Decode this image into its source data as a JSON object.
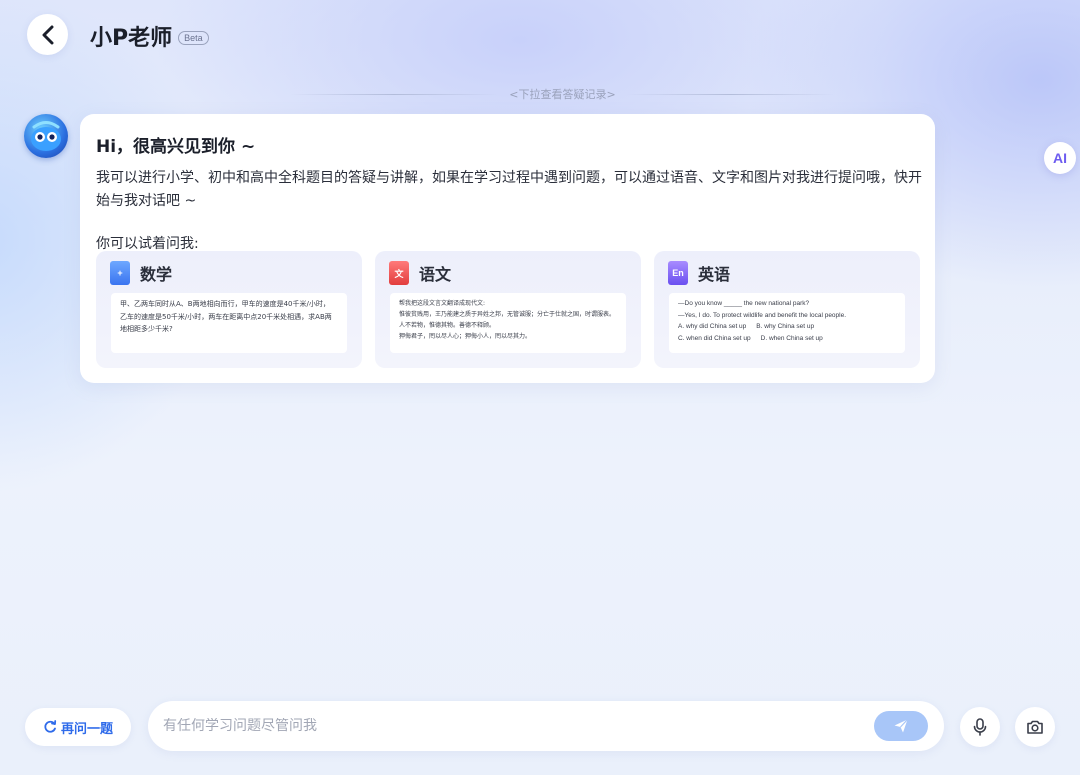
{
  "header": {
    "title": "小P老师",
    "badge": "Beta",
    "history_hint": "<下拉查看答疑记录>"
  },
  "message": {
    "greeting": "Hi，很高兴见到你 ~",
    "intro": "我可以进行小学、初中和高中全科题目的答疑与讲解，如果在学习过程中遇到问题，可以通过语音、文字和图片对我进行提问哦，快开始与我对话吧 ~",
    "try_label": "你可以试着问我:"
  },
  "subjects": [
    {
      "name": "数学",
      "icon": "math-book-icon",
      "lines": [
        "甲、乙两车同时从A、B两地相向而行，甲车的速度是40千米/小时，",
        "乙车的速度是50千米/小时，两车在距离中点20千米处相遇，求AB两",
        "地相距多少千米?"
      ]
    },
    {
      "name": "语文",
      "icon": "chinese-book-icon",
      "lines": [
        "帮我把这段文言文翻译成现代文:",
        "惟彼贫贱用，王乃能建之质于异姓之邦，无管诚服；分亡于仕就之国，时谓服表。",
        "人不若物，惟德其物。善德不释顾。",
        "狎侮君子，罔以尽人心；狎侮小人，罔以尽其力。"
      ]
    },
    {
      "name": "英语",
      "icon": "english-book-icon",
      "lines": [
        "—Do you know _____ the new national park?",
        "—Yes, I do. To protect wildlife and benefit the local people."
      ],
      "options": [
        [
          "A. why did China set up",
          "B. why China set up"
        ],
        [
          "C. when did China set up",
          "D. when China set up"
        ]
      ]
    }
  ],
  "ai_badge": "AI",
  "bottom": {
    "ask_again_label": "再问一题",
    "input_placeholder": "有任何学习问题尽管问我",
    "input_value": ""
  },
  "colors": {
    "accent_blue": "#2f6bea",
    "send_button": "#a8c6f8"
  }
}
